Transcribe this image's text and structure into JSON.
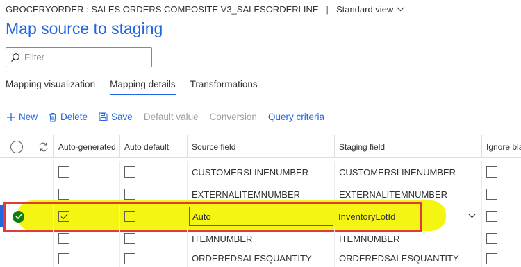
{
  "header": {
    "breadcrumb": "GROCERYORDER : SALES ORDERS COMPOSITE V3_SALESORDERLINE",
    "separator": "|",
    "view_label": "Standard view"
  },
  "page": {
    "title": "Map source to staging"
  },
  "filter": {
    "placeholder": "Filter"
  },
  "tabs": [
    {
      "label": "Mapping visualization"
    },
    {
      "label": "Mapping details",
      "active": true
    },
    {
      "label": "Transformations"
    }
  ],
  "actions": {
    "new": "New",
    "delete": "Delete",
    "save": "Save",
    "default_value": "Default value",
    "conversion": "Conversion",
    "query_criteria": "Query criteria"
  },
  "grid": {
    "columns": [
      "Auto-generated",
      "Auto default",
      "Source field",
      "Staging field",
      "Ignore bla"
    ],
    "rows": [
      {
        "auto_generated": false,
        "auto_default": false,
        "source": "CUSTOMERSLINENUMBER",
        "staging": "CUSTOMERSLINENUMBER",
        "ignore": false
      },
      {
        "auto_generated": false,
        "auto_default": false,
        "source": "EXTERNALITEMNUMBER",
        "staging": "EXTERNALITEMNUMBER",
        "ignore": false
      },
      {
        "auto_generated": true,
        "auto_default": false,
        "source": "Auto",
        "staging": "InventoryLotId",
        "ignore": false,
        "selected": true
      },
      {
        "auto_generated": false,
        "auto_default": false,
        "source": "ITEMNUMBER",
        "staging": "ITEMNUMBER",
        "ignore": false
      },
      {
        "auto_generated": false,
        "auto_default": false,
        "source": "ORDEREDSALESQUANTITY",
        "staging": "ORDEREDSALESQUANTITY",
        "ignore": false
      }
    ]
  },
  "colors": {
    "accent": "#2266e3",
    "highlight": "#f4f400",
    "annotation": "#e03b3b",
    "selected": "#107c10"
  }
}
